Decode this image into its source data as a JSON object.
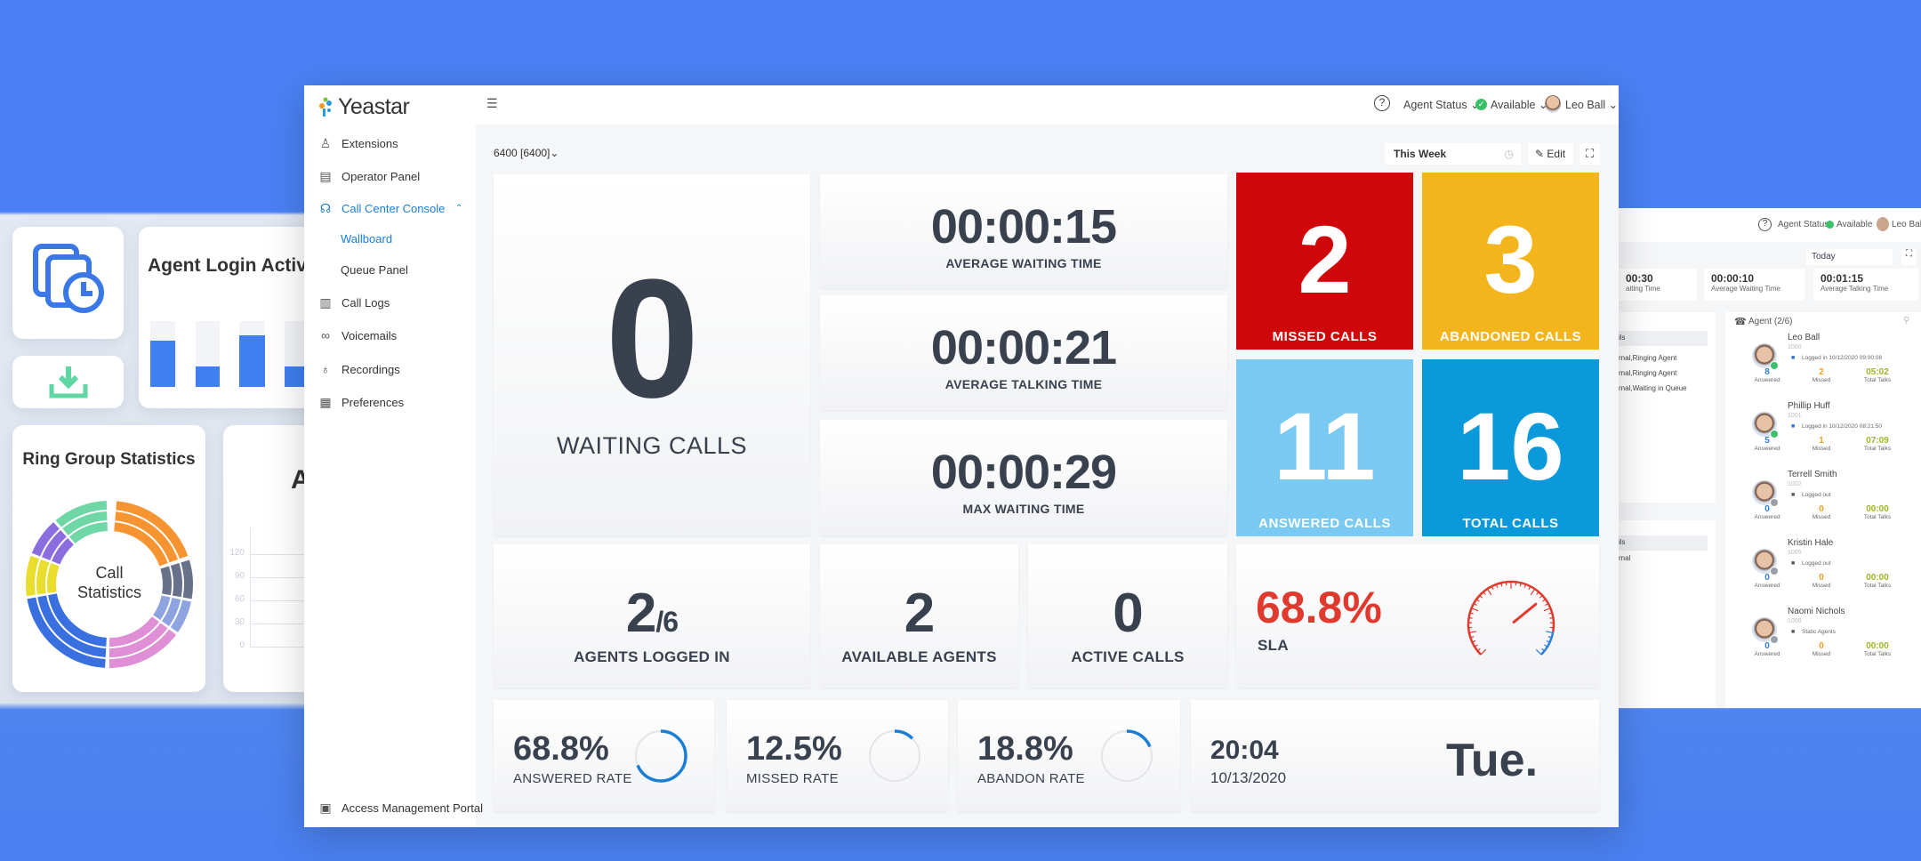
{
  "main": {
    "brand": "Yeastar",
    "sidebar": {
      "items": [
        {
          "label": "Extensions",
          "icon": "extensions-icon",
          "glyph": "♙"
        },
        {
          "label": "Operator Panel",
          "icon": "operator-panel-icon",
          "glyph": "▤"
        },
        {
          "label": "Call Center Console",
          "icon": "headset-icon",
          "glyph": "☊"
        },
        {
          "label": "Wallboard"
        },
        {
          "label": "Queue Panel"
        },
        {
          "label": "Call Logs",
          "icon": "call-logs-icon",
          "glyph": "▥"
        },
        {
          "label": "Voicemails",
          "icon": "voicemail-icon",
          "glyph": "∞"
        },
        {
          "label": "Recordings",
          "icon": "microphone-icon",
          "glyph": "♁"
        },
        {
          "label": "Preferences",
          "icon": "preferences-icon",
          "glyph": "▦"
        }
      ],
      "access": "Access Management Portal"
    },
    "header": {
      "agent_status": "Agent Status",
      "available": "Available",
      "user": "Leo Ball"
    },
    "queue_select": "6400 [6400]",
    "period": "This Week",
    "edit": "Edit",
    "waiting": {
      "value": "0",
      "label": "WAITING CALLS"
    },
    "times": [
      {
        "value": "00:00:15",
        "label": "AVERAGE WAITING TIME"
      },
      {
        "value": "00:00:21",
        "label": "AVERAGE TALKING TIME"
      },
      {
        "value": "00:00:29",
        "label": "MAX WAITING TIME"
      }
    ],
    "counts": [
      {
        "value": "2",
        "label": "MISSED CALLS",
        "color": "#d0070a"
      },
      {
        "value": "3",
        "label": "ABANDONED CALLS",
        "color": "#f4b51c"
      },
      {
        "value": "11",
        "label": "ANSWERED CALLS",
        "color": "#79c9f2"
      },
      {
        "value": "16",
        "label": "TOTAL CALLS",
        "color": "#0a99da"
      }
    ],
    "agents_logged": {
      "value": "2",
      "total": "/6",
      "label": "AGENTS LOGGED IN"
    },
    "available_agents": {
      "value": "2",
      "label": "AVAILABLE AGENTS"
    },
    "active_calls": {
      "value": "0",
      "label": "ACTIVE CALLS"
    },
    "sla": {
      "value": "68.8%",
      "label": "SLA",
      "percent": 68.8
    },
    "rates": [
      {
        "value": "68.8%",
        "label": "ANSWERED RATE",
        "percent": 68.8
      },
      {
        "value": "12.5%",
        "label": "MISSED RATE",
        "percent": 12.5
      },
      {
        "value": "18.8%",
        "label": "ABANDON RATE",
        "percent": 18.8
      }
    ],
    "clock": {
      "time": "20:04",
      "date": "10/13/2020",
      "day": "Tue."
    }
  },
  "left_cards": {
    "agent_login_title": "Agent Login Activity",
    "agent_login_bars": [
      0.7,
      0.31,
      0.78,
      0.31
    ],
    "ring_group_title": "Ring Group Statistics",
    "donut_center": [
      "Call",
      "Statistics"
    ],
    "donut_colors": [
      "#f59431",
      "#67718a",
      "#8ea4e0",
      "#de8fd6",
      "#3a6fe0",
      "#e9de2e",
      "#8a6ee0",
      "#6fd6a6"
    ],
    "partial_title": "A",
    "axis_ticks": [
      "120",
      "90",
      "60",
      "30",
      "0"
    ]
  },
  "second_window": {
    "agent_status": "Agent Status",
    "available": "Available",
    "user": "Leo Ball",
    "period": "Today",
    "stats": [
      {
        "value": "00:30",
        "label": "aiting Time"
      },
      {
        "value": "00:00:10",
        "label": "Average Waiting Time"
      },
      {
        "value": "00:01:15",
        "label": "Average Talking Time"
      }
    ],
    "queue_rows": [
      "ils",
      "rnal,Ringing Agent",
      "rnal,Ringing Agent",
      "rnal,Waiting in Queue"
    ],
    "queue_rows2": [
      "ils",
      "rnal"
    ],
    "agent_header": "Agent (2/6)",
    "agents": [
      {
        "name": "Leo Ball",
        "ext": "1000",
        "status": "Logged in 10/12/2020 09:00:08",
        "answered": "8",
        "missed": "2",
        "talks": "05:02",
        "online": true
      },
      {
        "name": "Phillip Huff",
        "ext": "1001",
        "status": "Logged in 10/12/2020 08:21:50",
        "answered": "5",
        "missed": "1",
        "talks": "07:09",
        "online": true
      },
      {
        "name": "Terrell Smith",
        "ext": "1002",
        "status": "Logged out",
        "answered": "0",
        "missed": "0",
        "talks": "00:00",
        "online": false
      },
      {
        "name": "Kristin Hale",
        "ext": "1005",
        "status": "Logged out",
        "answered": "0",
        "missed": "0",
        "talks": "00:00",
        "online": false
      },
      {
        "name": "Naomi Nichols",
        "ext": "1006",
        "status": "Static Agents",
        "answered": "0",
        "missed": "0",
        "talks": "00:00",
        "online": false
      }
    ],
    "stat_labels": {
      "answered": "Answered",
      "missed": "Missed",
      "talks": "Total Talks"
    }
  }
}
